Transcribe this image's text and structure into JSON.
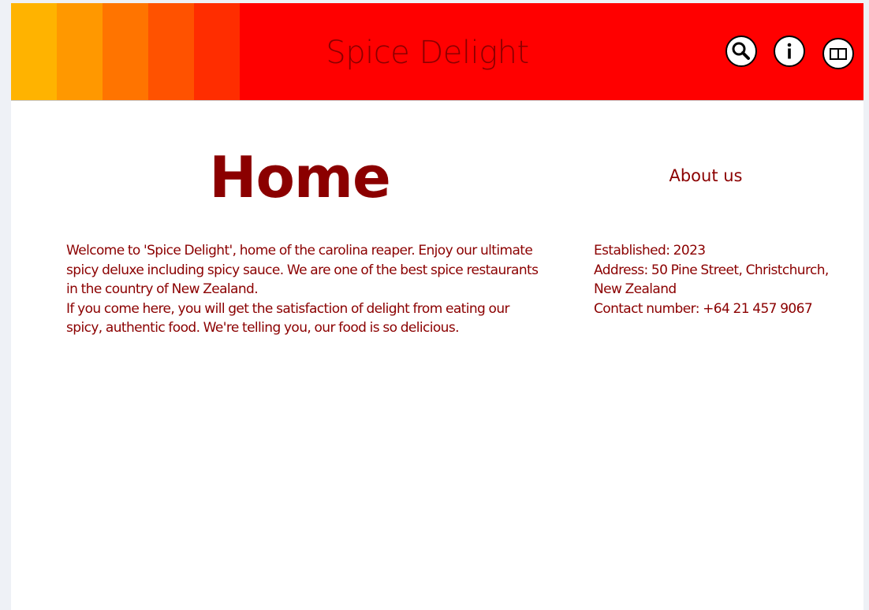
{
  "header": {
    "site_title": "Spice Delight",
    "stripe_colors": [
      "#ffb300",
      "#ff9800",
      "#ff7400",
      "#ff5200",
      "#ff2d00"
    ],
    "background_color": "#ff0000",
    "icons": [
      "search-icon",
      "info-icon",
      "book-icon"
    ]
  },
  "main": {
    "heading": "Home",
    "paragraphs": [
      "Welcome to 'Spice Delight', home of the carolina reaper. Enjoy our ultimate spicy deluxe including spicy sauce. We are one of the best spice restaurants in the country of New Zealand.",
      "If you come here, you will get the satisfaction of delight from eating our spicy, authentic food. We're telling you, our food is so delicious."
    ]
  },
  "about": {
    "heading": "About us",
    "established": "Established: 2023",
    "address": "Address: 50 Pine Street, Christchurch, New Zealand",
    "contact": "Contact number: +64 21 457 9067"
  },
  "colors": {
    "text": "#8b0000",
    "page_background": "#ffffff"
  }
}
